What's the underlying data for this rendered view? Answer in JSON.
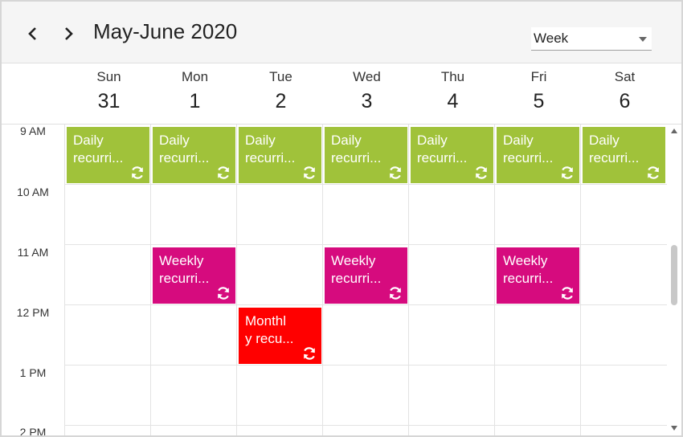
{
  "header": {
    "prev_icon": "chevron-left-icon",
    "next_icon": "chevron-right-icon",
    "title": "May-June 2020",
    "view": {
      "selected": "Week"
    }
  },
  "days": [
    {
      "name": "Sun",
      "date": "31"
    },
    {
      "name": "Mon",
      "date": "1"
    },
    {
      "name": "Tue",
      "date": "2"
    },
    {
      "name": "Wed",
      "date": "3"
    },
    {
      "name": "Thu",
      "date": "4"
    },
    {
      "name": "Fri",
      "date": "5"
    },
    {
      "name": "Sat",
      "date": "6"
    }
  ],
  "time_slots": [
    "9 AM",
    "10 AM",
    "11 AM",
    "12 PM",
    "1 PM",
    "2 PM"
  ],
  "colors": {
    "daily": "#a0c23a",
    "weekly": "#d60b7e",
    "monthly": "#ff0000"
  },
  "appointments": {
    "daily": {
      "line1": "Daily",
      "line2": "recurri..."
    },
    "weekly": {
      "line1": "Weekly",
      "line2": "recurri..."
    },
    "monthly": {
      "line1": "Monthl",
      "line2": "y recu..."
    },
    "icon": "recurrence-icon"
  }
}
